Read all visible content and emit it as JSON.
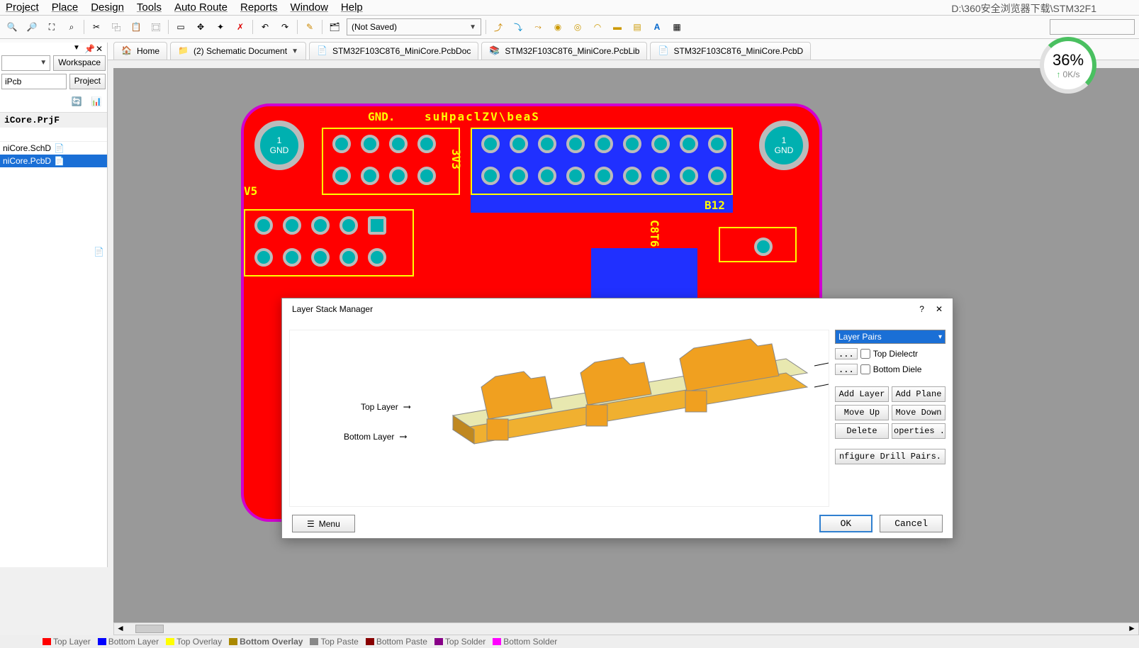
{
  "menu": {
    "project": "Project",
    "place": "Place",
    "design": "Design",
    "tools": "Tools",
    "autoroute": "Auto Route",
    "reports": "Reports",
    "window": "Window",
    "help": "Help"
  },
  "path_display": "D:\\360安全浏览器下载\\STM32F1",
  "toolbar": {
    "combo_value": "(Not Saved)"
  },
  "tabs": {
    "home": "Home",
    "schematic": "(2) Schematic Document",
    "pcbdoc": "STM32F103C8T6_MiniCore.PcbDoc",
    "pcblib": "STM32F103C8T6_MiniCore.PcbLib",
    "pcbd": "STM32F103C8T6_MiniCore.PcbD"
  },
  "panel": {
    "workspace_btn": "Workspace",
    "project_btn": "Project",
    "project_text": "iPcb",
    "project_name": "iCore.PrjF",
    "tree": {
      "sch": "niCore.SchD",
      "pcb": "niCore.PcbD"
    }
  },
  "pcb": {
    "gnd_num": "1",
    "gnd_label": "GND",
    "gnd_text": "GND.",
    "v5": "V5",
    "v3": "3V3",
    "b12": "B12",
    "mcu": "C8T6",
    "suhp": "suHpaclZV\\beaS"
  },
  "dialog": {
    "title": "Layer Stack Manager",
    "top_layer": "Top Layer",
    "bottom_layer": "Bottom Layer",
    "pairs_select": "Layer Pairs",
    "top_diel": "Top Dielectr",
    "bot_diel": "Bottom Diele",
    "btn_addlayer": "Add Layer",
    "btn_addplane": "Add Plane",
    "btn_moveup": "Move Up",
    "btn_movedown": "Move Down",
    "btn_delete": "Delete",
    "btn_props": "operties .",
    "btn_drill": "nfigure Drill Pairs.",
    "menu": "Menu",
    "ok": "OK",
    "cancel": "Cancel"
  },
  "gauge": {
    "pct": "36%",
    "sub": "0K/s"
  },
  "status": {
    "top": "Top Layer",
    "bottom": "Bottom Layer",
    "topov": "Top Overlay",
    "botov": "Bottom Overlay",
    "tpaste": "Top Paste",
    "bpaste": "Bottom Paste",
    "tsolder": "Top Solder",
    "bsolder": "Bottom Solder"
  }
}
